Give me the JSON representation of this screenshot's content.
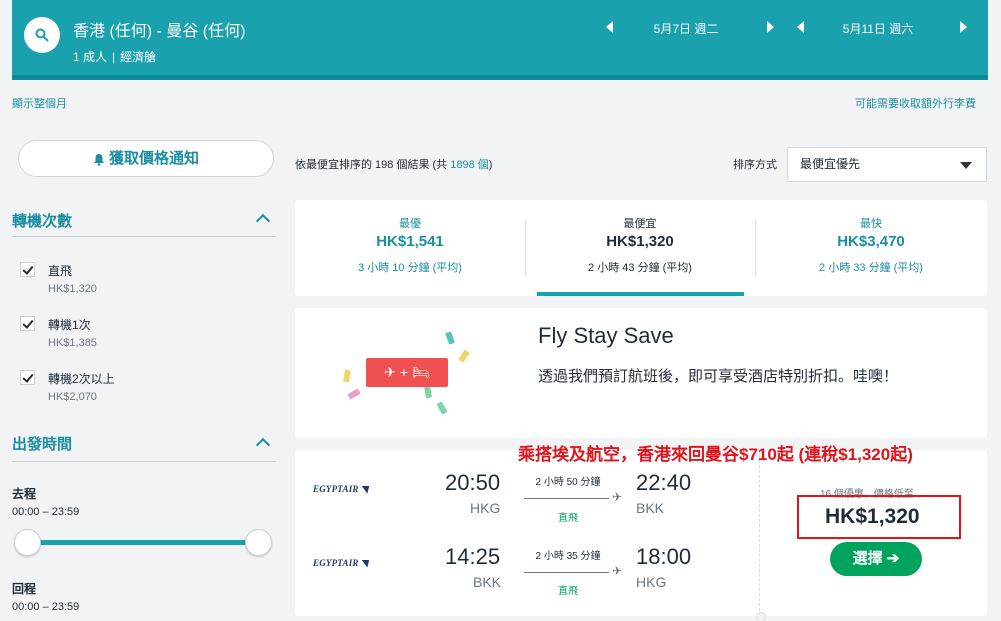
{
  "header": {
    "route": "香港 (任何) - 曼谷 (任何)",
    "passengers": "1 成人",
    "cabin": "經濟艙",
    "depart_date": "5月7日 週二",
    "return_date": "5月11日 週六"
  },
  "links": {
    "show_month": "顯示整個月",
    "extra_fees": "可能需要收取額外行李費"
  },
  "price_alert": {
    "label": "獲取價格通知"
  },
  "filters": {
    "stops_title": "轉機次數",
    "stops": [
      {
        "label": "直飛",
        "price": "HK$1,320"
      },
      {
        "label": "轉機1次",
        "price": "HK$1,385"
      },
      {
        "label": "轉機2次以上",
        "price": "HK$2,070"
      }
    ],
    "time_title": "出發時間",
    "outbound_label": "去程",
    "outbound_range": "00:00 – 23:59",
    "return_label": "回程",
    "return_range": "00:00 – 23:59"
  },
  "results": {
    "count_prefix": "依最便宜排序的 198 個結果 (共 ",
    "total": "1898 個",
    "count_suffix": ")",
    "sort_label": "排序方式",
    "sort_value": "最便宜優先"
  },
  "sort_tabs": [
    {
      "label": "最優",
      "price": "HK$1,541",
      "duration": "3 小時 10 分鐘 (平均)"
    },
    {
      "label": "最便宜",
      "price": "HK$1,320",
      "duration": "2 小時 43 分鐘 (平均)"
    },
    {
      "label": "最快",
      "price": "HK$3,470",
      "duration": "2 小時 33 分鐘 (平均)"
    }
  ],
  "promo": {
    "title": "Fly Stay Save",
    "text": "透過我們預訂航班後，即可享受酒店特別折扣。哇噢！",
    "badge": "✈ + 🛏"
  },
  "flight": {
    "airline": "EGYPTAIR",
    "legs": [
      {
        "depart_time": "20:50",
        "depart_code": "HKG",
        "duration": "2 小時 50 分鐘",
        "stops": "直飛",
        "arrive_time": "22:40",
        "arrive_code": "BKK"
      },
      {
        "depart_time": "14:25",
        "depart_code": "BKK",
        "duration": "2 小時 35 分鐘",
        "stops": "直飛",
        "arrive_time": "18:00",
        "arrive_code": "HKG"
      }
    ],
    "deals": "16 個優惠，價格低至",
    "price": "HK$1,320",
    "select_label": "選擇 ➔"
  },
  "annotation": {
    "text": "乘搭埃及航空，香港來回曼谷$710起 (連稅$1,320起)"
  },
  "colors": {
    "brand_teal": "#1aa1ae",
    "link_teal": "#1a8fa0",
    "select_green": "#00a35c",
    "annotation_red": "#e0141b",
    "promo_red": "#f05050"
  }
}
